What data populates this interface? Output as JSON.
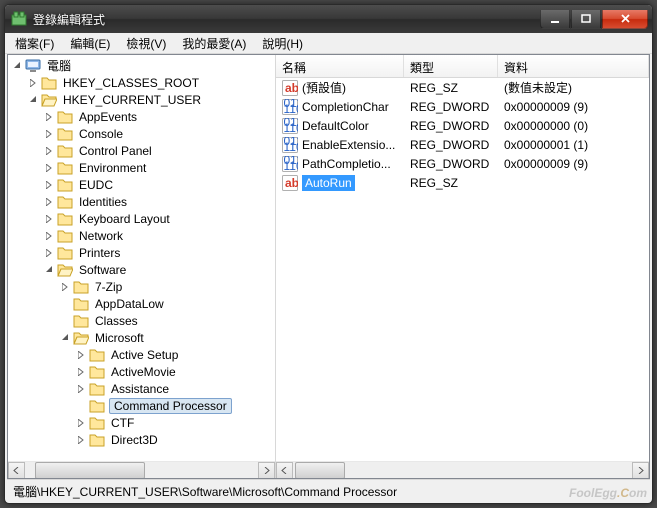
{
  "window": {
    "title": "登錄編輯程式"
  },
  "menu": [
    "檔案(F)",
    "編輯(E)",
    "檢視(V)",
    "我的最愛(A)",
    "說明(H)"
  ],
  "tree": {
    "root": "電腦",
    "l1": [
      {
        "t": false,
        "label": "HKEY_CLASSES_ROOT"
      },
      {
        "t": true,
        "label": "HKEY_CURRENT_USER"
      }
    ],
    "l2": [
      {
        "label": "AppEvents"
      },
      {
        "label": "Console"
      },
      {
        "label": "Control Panel"
      },
      {
        "label": "Environment"
      },
      {
        "label": "EUDC"
      },
      {
        "label": "Identities"
      },
      {
        "label": "Keyboard Layout"
      },
      {
        "label": "Network"
      },
      {
        "label": "Printers"
      },
      {
        "label": "Software",
        "open": true
      }
    ],
    "l3": [
      {
        "label": "7-Zip",
        "hasChild": true
      },
      {
        "label": "AppDataLow"
      },
      {
        "label": "Classes"
      },
      {
        "label": "Microsoft",
        "open": true
      }
    ],
    "l4": [
      {
        "label": "Active Setup",
        "hasChild": true
      },
      {
        "label": "ActiveMovie",
        "hasChild": true
      },
      {
        "label": "Assistance",
        "hasChild": true
      },
      {
        "label": "Command Processor",
        "selected": true
      },
      {
        "label": "CTF",
        "hasChild": true
      },
      {
        "label": "Direct3D",
        "hasChild": true
      }
    ]
  },
  "list": {
    "columns": {
      "name": "名稱",
      "type": "類型",
      "data": "資料"
    },
    "widths": {
      "name": 128,
      "type": 94,
      "data": 150
    },
    "rows": [
      {
        "icon": "sz",
        "name": "(預設值)",
        "type": "REG_SZ",
        "data": "(數值未設定)"
      },
      {
        "icon": "dw",
        "name": "CompletionChar",
        "type": "REG_DWORD",
        "data": "0x00000009 (9)"
      },
      {
        "icon": "dw",
        "name": "DefaultColor",
        "type": "REG_DWORD",
        "data": "0x00000000 (0)"
      },
      {
        "icon": "dw",
        "name": "EnableExtensio...",
        "type": "REG_DWORD",
        "data": "0x00000001 (1)"
      },
      {
        "icon": "dw",
        "name": "PathCompletio...",
        "type": "REG_DWORD",
        "data": "0x00000009 (9)"
      },
      {
        "icon": "sz",
        "name": "AutoRun",
        "type": "REG_SZ",
        "data": "",
        "selected": true
      }
    ]
  },
  "statusbar": "電腦\\HKEY_CURRENT_USER\\Software\\Microsoft\\Command Processor",
  "watermark": {
    "a": "FoolEgg",
    "b": ".C",
    "c": "om"
  }
}
